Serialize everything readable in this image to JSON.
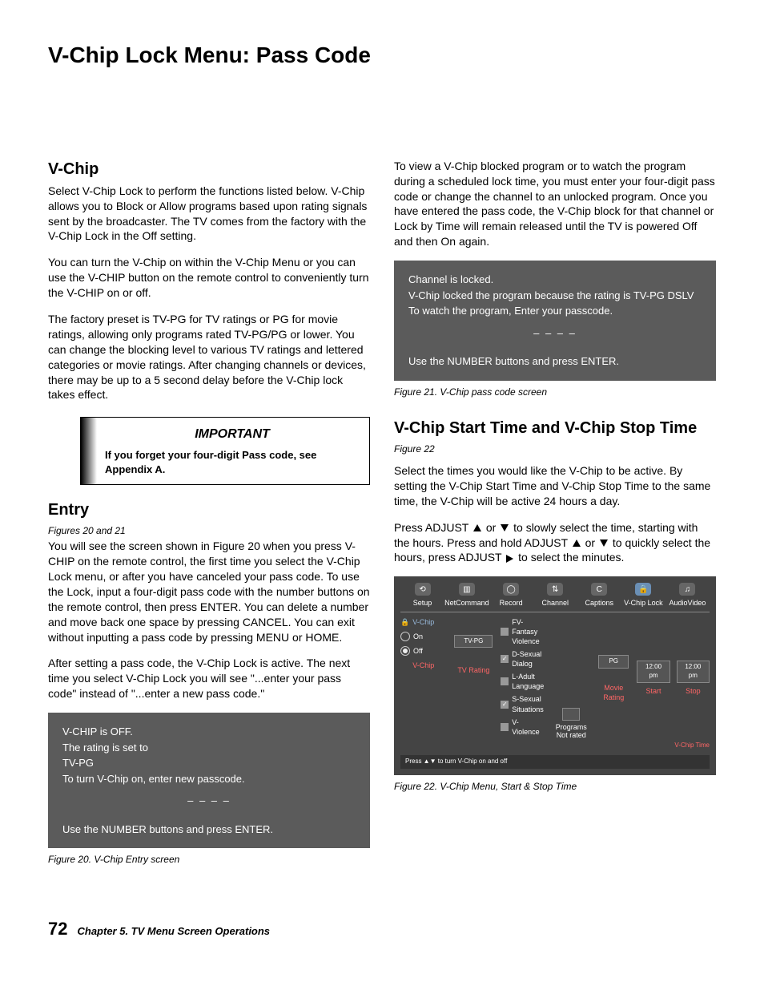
{
  "title": "V-Chip Lock Menu: Pass Code",
  "left": {
    "h_vchip": "V-Chip",
    "p1": "Select V-Chip Lock to perform the functions listed below.  V-Chip allows you to Block or Allow programs based upon rating signals sent by the broadcaster.  The TV comes from the factory with the V-Chip Lock in the Off setting.",
    "p2": "You can turn the V-Chip on within the V-Chip Menu or you can use the V-CHIP button on the remote control to conveniently turn the V-CHIP on or off.",
    "p3": "The factory preset is TV-PG for TV ratings or PG for movie ratings, allowing only programs rated TV-PG/PG or lower.  You can change the blocking level to various TV ratings and lettered categories or movie ratings.  After changing channels or devices, there may be up to a 5 second delay before the V-Chip lock takes effect.",
    "important_title": "IMPORTANT",
    "important_body": "If you forget your four-digit Pass code, see Appendix A.",
    "h_entry": "Entry",
    "entry_ref": "Figures 20 and 21",
    "entry_p1": "You will see the screen shown in Figure 20 when you press V-CHIP on the remote control, the first time you select the V-Chip Lock menu, or after you have canceled your pass code.  To use the Lock, input a four-digit pass code with the number buttons on the remote control, then press ENTER.  You can delete a number and move back one space by pressing CANCEL.  You can exit without inputting a pass code by pressing MENU or HOME.",
    "entry_p2": "After setting a pass code, the V-Chip Lock is active.  The next time you select V-Chip Lock you will see \"...enter your pass code\" instead of \"...enter a new pass code.\"",
    "shot1_l1": "V-CHIP is OFF.",
    "shot1_l2": "The rating is set to",
    "shot1_l3": "TV-PG",
    "shot1_l4": "To turn V-Chip on, enter new passcode.",
    "shot1_dashes": "– – – –",
    "shot1_l5": "Use the NUMBER buttons and press ENTER.",
    "caption20": "Figure 20. V-Chip Entry screen"
  },
  "right": {
    "p1": "To view a V-Chip blocked program or to watch the program during a scheduled lock time, you must enter your four-digit pass code or change the channel to an unlocked program.  Once you have entered the pass code, the V-Chip block for that channel or Lock by Time will remain released until the TV is powered Off and then On again.",
    "shot2_l1": "Channel is locked.",
    "shot2_l2": "V-Chip locked the program because the rating is TV-PG DSLV",
    "shot2_l3": "To watch the program, Enter your passcode.",
    "shot2_dashes": "– – – –",
    "shot2_l4": "Use the NUMBER buttons and press ENTER.",
    "caption21": "Figure 21. V-Chip pass code screen",
    "h_time": "V-Chip Start Time and V-Chip Stop Time",
    "time_ref": "Figure 22",
    "time_p1": "Select the times you would like the V-Chip to be active.  By setting the V-Chip Start Time and V-Chip Stop Time to the same time, the V-Chip will be active 24 hours a day.",
    "time_p2_a": "Press ADJUST ",
    "time_p2_b": " or  ",
    "time_p2_c": " to slowly select the time, starting with the hours.  Press and hold ADJUST ",
    "time_p2_d": " or ",
    "time_p2_e": " to quickly select the hours, press ADJUST ",
    "time_p2_f": " to select the minutes.",
    "caption22": "Figure 22. V-Chip Menu, Start & Stop Time"
  },
  "menu": {
    "tabs": [
      "Setup",
      "NetCommand",
      "Record",
      "Channel",
      "Captions",
      "V-Chip Lock",
      "AudioVideo"
    ],
    "left_head": "V-Chip",
    "left_on": "On",
    "left_off": "Off",
    "left_label": "V-Chip",
    "tvpg": "TV-PG",
    "tvrating": "TV Rating",
    "rows": [
      "FV-Fantasy Violence",
      "D-Sexual Dialog",
      "L-Adult Language",
      "S-Sexual Situations",
      "V-Violence"
    ],
    "programs": "Programs Not rated",
    "pg": "PG",
    "movie": "Movie Rating",
    "start_time": "12:00 pm",
    "stop_time": "12:00 pm",
    "start": "Start",
    "stop": "Stop",
    "vchip_time": "V-Chip Time",
    "hint": "Press ▲▼ to turn V-Chip on and off"
  },
  "footer": {
    "page": "72",
    "chapter": "Chapter 5. TV Menu Screen Operations"
  }
}
